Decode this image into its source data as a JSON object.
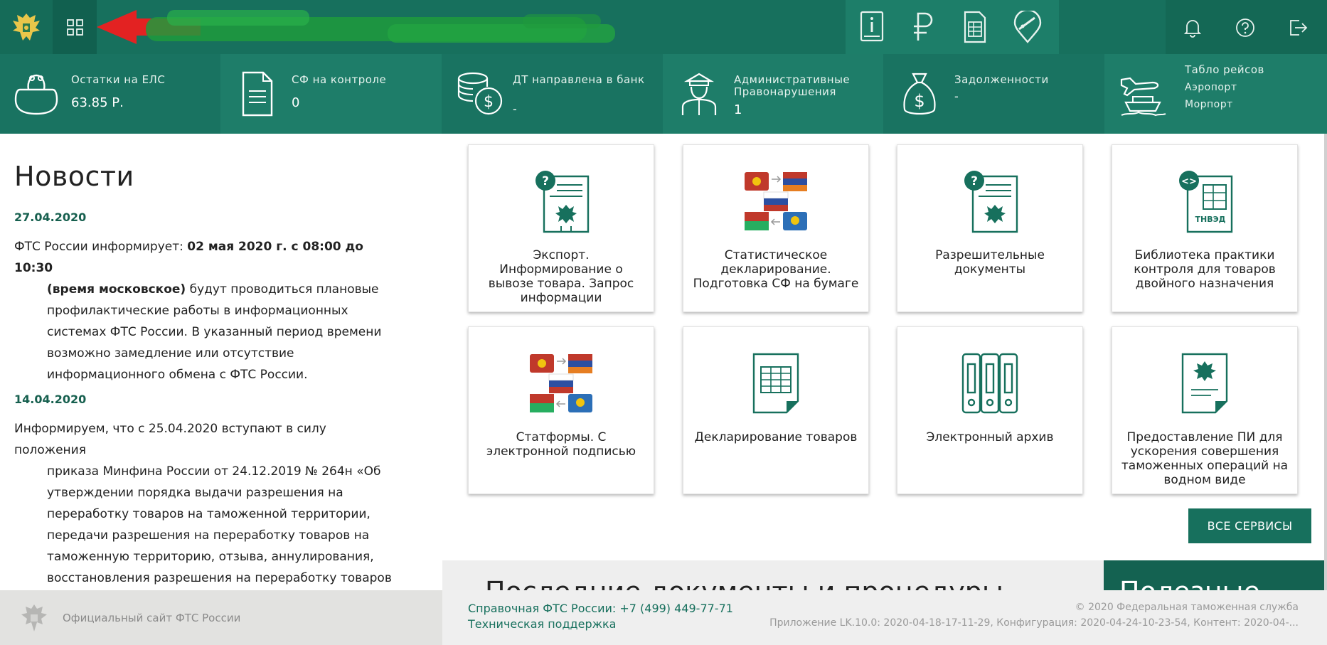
{
  "colors": {
    "brand": "#17705d",
    "brand_dark": "#11604f",
    "accent_red": "#e32222",
    "text": "#222222"
  },
  "infobar": [
    {
      "label": "Остатки на ЕЛС",
      "value": "63.85 Р.",
      "icon": "wallet-icon"
    },
    {
      "label": "СФ на контроле",
      "value": "0",
      "icon": "document-icon"
    },
    {
      "label": "ДТ направлена в банк",
      "value": "-",
      "icon": "coins-icon"
    },
    {
      "label": "Административные Правонарушения",
      "value": "1",
      "icon": "officer-icon"
    },
    {
      "label": "Задолженности",
      "value": "-",
      "icon": "money-bag-icon"
    },
    {
      "label": "Табло рейсов",
      "value": "",
      "links": [
        "Аэропорт",
        "Морпорт"
      ],
      "icon": "plane-ship-icon"
    }
  ],
  "news": {
    "title": "Новости",
    "items": [
      {
        "date": "27.04.2020",
        "lead": "ФТС России информирует: ",
        "bold_first": "02 мая 2020 г. с  08:00 до 10:30",
        "bold_second": "(время московское)",
        "rest": " будут проводиться плановые профилактические работы в информационных системах ФТС России. В указанный период времени возможно замедление или отсутствие информационного обмена с ФТС России."
      },
      {
        "date": "14.04.2020",
        "lead": "Информируем, что с 25.04.2020 вступают в силу положения",
        "rest": "приказа Минфина России от 24.12.2019 № 264н «Об утверждении порядка выдачи разрешения на переработку товаров на таможенной территории, передачи разрешения на переработку товаров на таможенную территорию, отзыва, аннулирования, восстановления разрешения на переработку товаров на таможенной территории и порядка его"
      }
    ]
  },
  "services": [
    {
      "label": "Экспорт. Информирование о вывозе товара. Запрос информации",
      "icon": "export-info-icon"
    },
    {
      "label": "Статистическое декларирование. Подготовка СФ на бумаге",
      "icon": "flags-exchange-icon"
    },
    {
      "label": "Разрешительные документы",
      "icon": "permit-document-icon"
    },
    {
      "label": "Библиотека практики контроля для товаров двойного назначения",
      "icon": "tnved-library-icon",
      "badge": "ТНВЭД"
    },
    {
      "label": "Статформы. С электронной подписью",
      "icon": "flags-exchange-icon"
    },
    {
      "label": "Декларирование товаров",
      "icon": "declaration-table-icon"
    },
    {
      "label": "Электронный архив",
      "icon": "binders-icon"
    },
    {
      "label": "Предоставление ПИ для ускорения совершения таможенных операций на водном виде",
      "icon": "emblem-document-icon"
    }
  ],
  "all_services_label": "ВСЕ СЕРВИСЫ",
  "recent_docs_heading": "Последние документы и процедуры",
  "useful_heading": "Полезные",
  "footer": {
    "site": "Официальный сайт ФТС России",
    "phone": "Справочная ФТС России: +7 (499) 449-77-71",
    "support": "Техническая поддержка",
    "copyright": "© 2020 Федеральная таможенная служба",
    "version": "Приложение LK.10.0: 2020-04-18-17-11-29, Конфигурация: 2020-04-24-10-23-54, Контент: 2020-04-..."
  }
}
